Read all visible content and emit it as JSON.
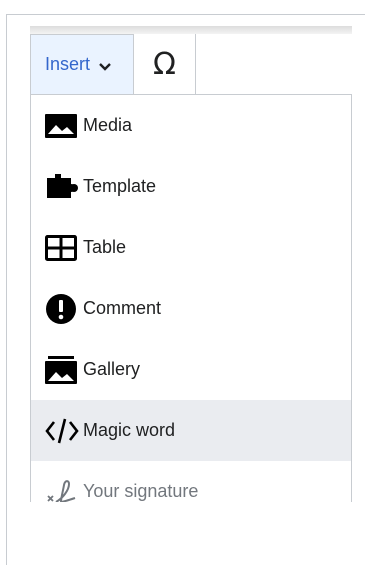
{
  "toolbar": {
    "insert_label": "Insert",
    "special_char_label": "Ω"
  },
  "menu": {
    "items": [
      {
        "label": "Media",
        "icon": "media-icon"
      },
      {
        "label": "Template",
        "icon": "template-icon"
      },
      {
        "label": "Table",
        "icon": "table-icon"
      },
      {
        "label": "Comment",
        "icon": "comment-icon"
      },
      {
        "label": "Gallery",
        "icon": "gallery-icon"
      },
      {
        "label": "Magic word",
        "icon": "code-icon"
      },
      {
        "label": "Your signature",
        "icon": "signature-icon"
      }
    ],
    "hovered_item": "Magic word",
    "disabled_item": "Your signature"
  },
  "colors": {
    "accent": "#3366cc",
    "active_bg": "#eaf3ff",
    "hover_bg": "#eaecf0",
    "border": "#c8ccd1",
    "text": "#202122",
    "disabled_text": "#72777d"
  }
}
